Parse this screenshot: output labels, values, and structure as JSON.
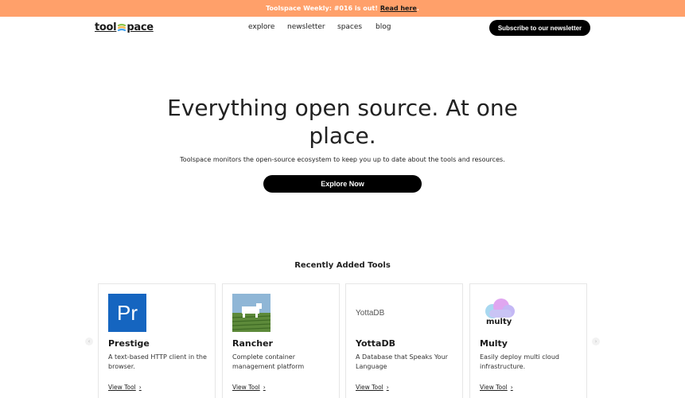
{
  "announcement": {
    "text": "Toolspace Weekly: #016 is out!",
    "link": "Read here",
    "suffix": "."
  },
  "brand": {
    "logo_left": "tool",
    "logo_right": "pace"
  },
  "nav": {
    "items": [
      "explore",
      "newsletter",
      "spaces",
      "blog"
    ]
  },
  "subscribe_label": "Subscribe to our newsletter",
  "hero": {
    "title": "Everything open source. At one place.",
    "subtitle": "Toolspace monitors the open-source ecosystem to keep you up to date about the tools and resources.",
    "cta": "Explore Now"
  },
  "recent": {
    "title": "Recently Added Tools",
    "view_label": "View Tool",
    "tools": [
      {
        "name": "Prestige",
        "desc": "A text-based HTTP client in the browser.",
        "thumb_text": "Pr"
      },
      {
        "name": "Rancher",
        "desc": "Complete container management platform"
      },
      {
        "name": "YottaDB",
        "desc": "A Database that Speaks Your Language",
        "thumb_text": "YottaDB"
      },
      {
        "name": "Multy",
        "desc": "Easily deploy multi cloud infrastructure.",
        "thumb_text": "multy"
      }
    ]
  },
  "colors": {
    "announce_bg": "#ffa06a",
    "prestige_blue": "#1565c0",
    "button_black": "#000000"
  },
  "icons": {
    "arrow_left": "chevron-left-icon",
    "arrow_right": "chevron-right-icon",
    "view_chevron": "chevron-right-icon"
  }
}
